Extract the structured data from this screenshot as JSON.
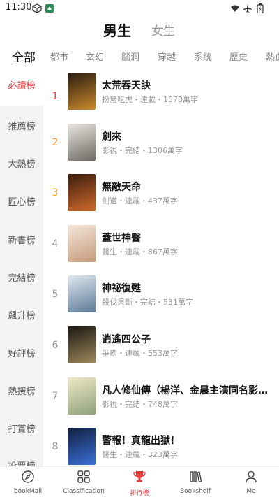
{
  "status_bar": {
    "time": "11:30"
  },
  "gender_tabs": [
    {
      "label": "男生",
      "active": true
    },
    {
      "label": "女生",
      "active": false
    }
  ],
  "categories": [
    "全部",
    "都市",
    "玄幻",
    "腦洞",
    "穿越",
    "系統",
    "歷史",
    "熱血"
  ],
  "sidebar": {
    "items": [
      "必讀榜",
      "推薦榜",
      "大熱榜",
      "匠心榜",
      "新書榜",
      "完結榜",
      "飆升榜",
      "好評榜",
      "熱搜榜",
      "打賞榜",
      "投票榜"
    ]
  },
  "books": [
    {
      "rank": "1",
      "title": "太荒吞天訣",
      "meta": "扮豬吃虎・連載・1578萬字",
      "cover_colors": [
        "#2a1c12",
        "#c98a2b"
      ]
    },
    {
      "rank": "2",
      "title": "劍來",
      "meta": "影視・完結・1306萬字",
      "cover_colors": [
        "#e9e6df",
        "#6d6a63"
      ]
    },
    {
      "rank": "3",
      "title": "無敵天命",
      "meta": "劍道・連載・437萬字",
      "cover_colors": [
        "#3b1d10",
        "#d06a2a"
      ]
    },
    {
      "rank": "4",
      "title": "蓋世神醫",
      "meta": "醫生・連載・867萬字",
      "cover_colors": [
        "#f4e7da",
        "#c49a7a"
      ]
    },
    {
      "rank": "5",
      "title": "神祕復甦",
      "meta": "殺伐果斷・完結・531萬字",
      "cover_colors": [
        "#dfe8f0",
        "#5d7a96"
      ]
    },
    {
      "rank": "6",
      "title": "逍遙四公子",
      "meta": "爭霸・連載・553萬字",
      "cover_colors": [
        "#1b1712",
        "#a08a5c"
      ]
    },
    {
      "rank": "7",
      "title": "凡人修仙傳（楊洋、金晨主演同名影視原…",
      "meta": "影視・完結・748萬字",
      "cover_colors": [
        "#efe8c6",
        "#8fa17a"
      ]
    },
    {
      "rank": "8",
      "title": "警報！真龍出獄！",
      "meta": "醫生・連載・323萬字",
      "cover_colors": [
        "#12203f",
        "#3a6fd8"
      ]
    }
  ],
  "bottom_nav": [
    {
      "label": "bookMall",
      "icon": "compass-icon",
      "active": false
    },
    {
      "label": "Classification",
      "icon": "grid-icon",
      "active": false
    },
    {
      "label": "排行榜",
      "icon": "trophy-icon",
      "active": true
    },
    {
      "label": "Bookshelf",
      "icon": "bookshelf-icon",
      "active": false
    },
    {
      "label": "Me",
      "icon": "person-icon",
      "active": false
    }
  ],
  "colors": {
    "accent": "#e8383d",
    "sidebar_bg": "#f3f3f3"
  }
}
